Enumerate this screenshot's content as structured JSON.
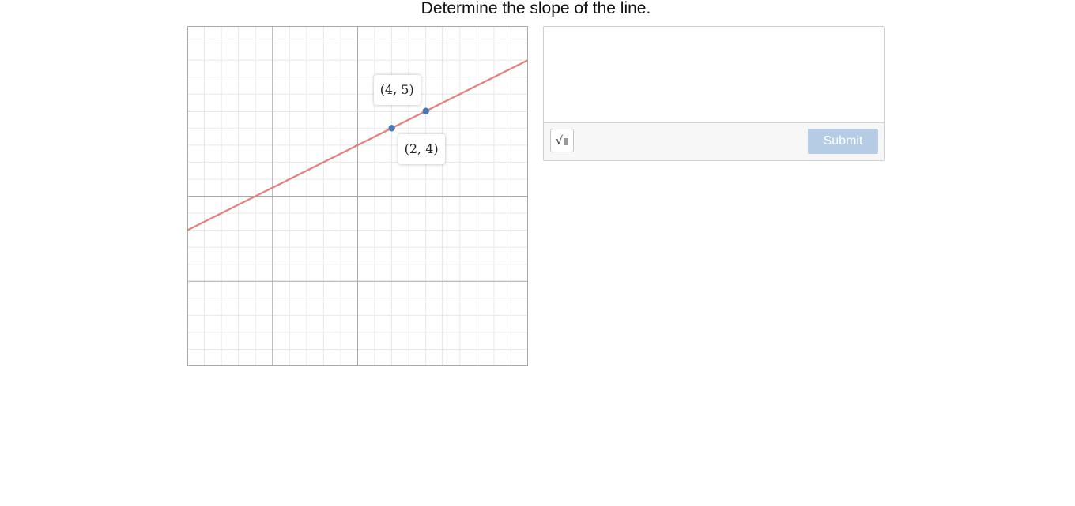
{
  "prompt": "Determine the slope of the line.",
  "graph": {
    "x_range": [
      -10,
      10
    ],
    "y_range": [
      -10,
      10
    ],
    "minor_step": 1,
    "major_step": 5,
    "line": {
      "color": "#e0827a",
      "passes_through": [
        [
          2,
          4
        ],
        [
          4,
          5
        ]
      ],
      "slope": 0.5
    },
    "points": [
      {
        "x": 2,
        "y": 4,
        "label": "(2, 4)",
        "color": "#4a77b4"
      },
      {
        "x": 4,
        "y": 5,
        "label": "(4, 5)",
        "color": "#4a77b4"
      }
    ]
  },
  "answer": {
    "value": "",
    "sqrt_icon": "sqrt-icon",
    "submit_label": "Submit"
  }
}
